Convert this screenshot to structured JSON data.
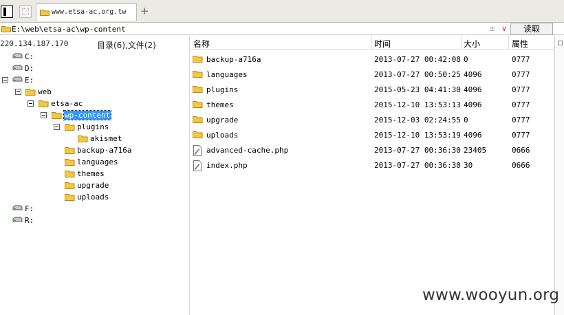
{
  "tabs": {
    "active_title": "www.etsa-ac.org.tw",
    "new_tab_symbol": "+"
  },
  "address": {
    "path": "E:\\web\\etsa-ac\\wp-content",
    "controls": "±",
    "dropdown": "∨",
    "read_button": "读取"
  },
  "left": {
    "ip": "220.134.187.170",
    "summary": "目录(6),文件(2)",
    "tree": [
      {
        "label": "C:",
        "type": "drive"
      },
      {
        "label": "D:",
        "type": "drive"
      },
      {
        "label": "E:",
        "type": "drive"
      },
      {
        "label": "web",
        "type": "folder"
      },
      {
        "label": "etsa-ac",
        "type": "folder"
      },
      {
        "label": "wp-content",
        "type": "folder",
        "selected": true
      },
      {
        "label": "plugins",
        "type": "folder"
      },
      {
        "label": "akismet",
        "type": "folder"
      },
      {
        "label": "backup-a716a",
        "type": "folder"
      },
      {
        "label": "languages",
        "type": "folder"
      },
      {
        "label": "themes",
        "type": "folder"
      },
      {
        "label": "upgrade",
        "type": "folder"
      },
      {
        "label": "uploads",
        "type": "folder"
      },
      {
        "label": "F:",
        "type": "drive"
      },
      {
        "label": "R:",
        "type": "drive"
      }
    ]
  },
  "columns": {
    "name": "名称",
    "time": "时间",
    "size": "大小",
    "attr": "属性"
  },
  "files": [
    {
      "name": "backup-a716a",
      "time": "2013-07-27 00:42:08",
      "size": "0",
      "attr": "0777",
      "type": "folder"
    },
    {
      "name": "languages",
      "time": "2013-07-27 00:50:25",
      "size": "4096",
      "attr": "0777",
      "type": "folder"
    },
    {
      "name": "plugins",
      "time": "2015-05-23 04:41:30",
      "size": "4096",
      "attr": "0777",
      "type": "folder"
    },
    {
      "name": "themes",
      "time": "2015-12-10 13:53:13",
      "size": "4096",
      "attr": "0777",
      "type": "folder"
    },
    {
      "name": "upgrade",
      "time": "2015-12-03 02:24:55",
      "size": "0",
      "attr": "0777",
      "type": "folder"
    },
    {
      "name": "uploads",
      "time": "2015-12-10 13:53:19",
      "size": "4096",
      "attr": "0777",
      "type": "folder"
    },
    {
      "name": "advanced-cache.php",
      "time": "2013-07-27 00:36:30",
      "size": "23405",
      "attr": "0666",
      "type": "file"
    },
    {
      "name": "index.php",
      "time": "2013-07-27 00:36:30",
      "size": "30",
      "attr": "0666",
      "type": "file"
    }
  ],
  "watermark": "www.wooyun.org",
  "colors": {
    "folder": "#f5c842",
    "selection": "#3399ff",
    "tabbar": "#eceae4"
  }
}
